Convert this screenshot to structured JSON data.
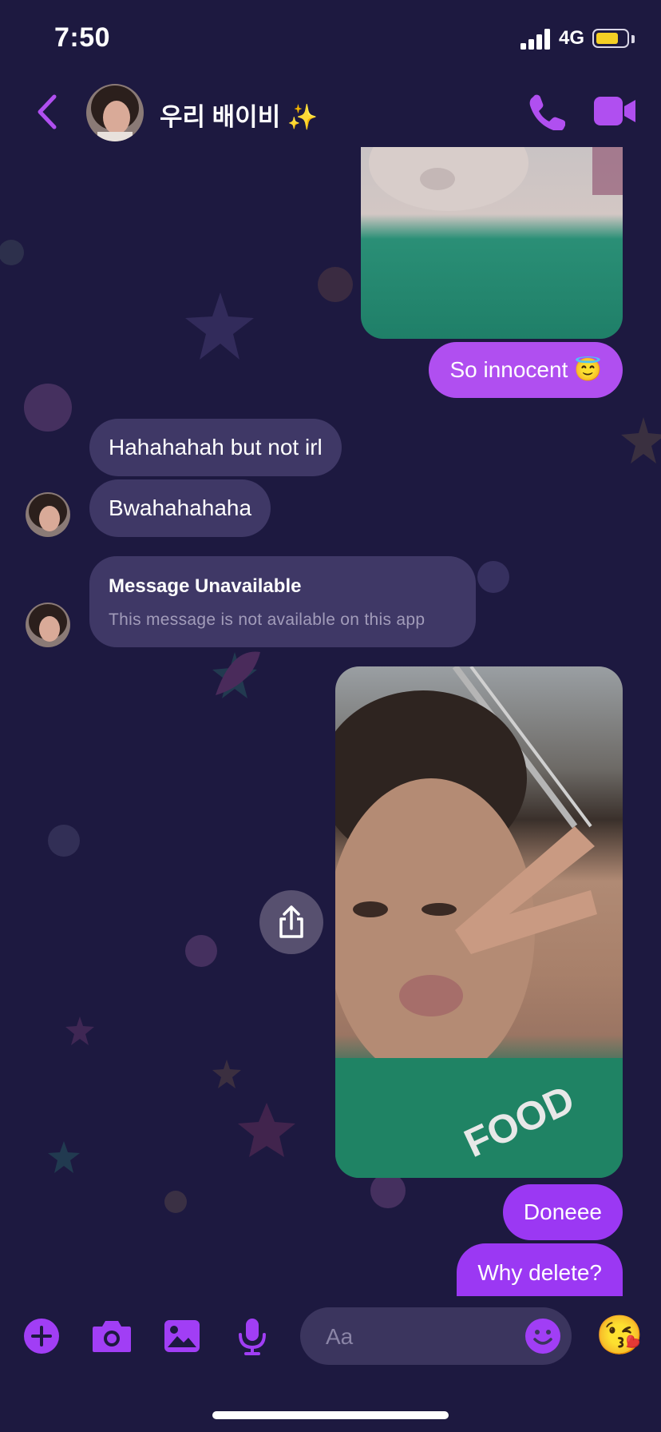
{
  "status_bar": {
    "time": "7:50",
    "network": "4G",
    "battery_level": 0.75
  },
  "header": {
    "back_icon": "chevron-left-icon",
    "title": "우리 배이비 ✨",
    "call_icon": "phone-icon",
    "video_icon": "video-camera-icon"
  },
  "messages": {
    "m1": "So innocent 😇",
    "m2": "Hahahahah but not irl",
    "m3": "Bwahahahaha",
    "unavailable_title": "Message Unavailable",
    "unavailable_sub": "This message is not available on this app",
    "m4": "Doneee",
    "m5": "Why delete?"
  },
  "composer": {
    "placeholder": "Aa",
    "icons": [
      "plus-icon",
      "camera-icon",
      "image-icon",
      "microphone-icon",
      "smiley-icon"
    ],
    "emoji": "😘"
  },
  "colors": {
    "background": "#1d1940",
    "outgoing_bubble": "#a13ef5",
    "incoming_bubble": "#3f3866",
    "accent": "#b04ff0"
  }
}
